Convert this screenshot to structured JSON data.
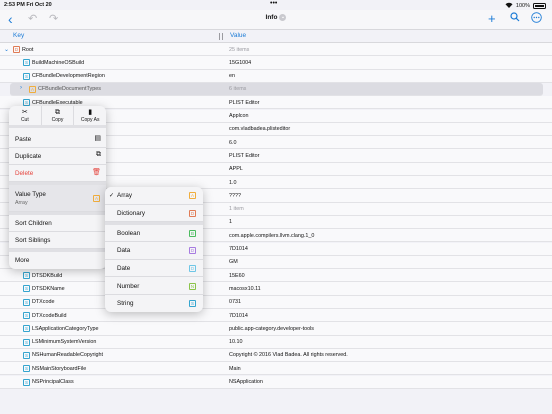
{
  "status": {
    "time": "2:53 PM",
    "date": "Fri Oct 20",
    "battery": "100%",
    "dots": "•••"
  },
  "nav": {
    "title": "Info",
    "chevron": "⌄",
    "back": "‹",
    "undo": "↶",
    "redo": "↷",
    "add": "+",
    "search": "⚲",
    "more": "⋯"
  },
  "header": {
    "key": "Key",
    "value": "Value"
  },
  "rows": [
    {
      "key": "Root",
      "value": "25 items",
      "type": "D",
      "typeclass": "dict",
      "indent": 1,
      "disc": "⌄",
      "gray": true
    },
    {
      "key": "BuildMachineOSBuild",
      "value": "15G1004",
      "type": "S",
      "indent": 2
    },
    {
      "key": "CFBundleDevelopmentRegion",
      "value": "en",
      "type": "S",
      "indent": 2
    },
    {
      "key": "CFBundleDocumentTypes",
      "value": "6 items",
      "type": "A",
      "typeclass": "arr",
      "indent": 2,
      "disc": "›",
      "gray": true,
      "selected": true
    },
    {
      "key": "CFBundleExecutable",
      "value": "PLIST Editor",
      "type": "S",
      "indent": 2
    },
    {
      "key": "",
      "value": "Applcon",
      "type": "",
      "indent": 2
    },
    {
      "key": "",
      "value": "com.vladbadea.plisteditor",
      "type": "",
      "indent": 2
    },
    {
      "key": "",
      "value": "6.0",
      "type": "",
      "indent": 2
    },
    {
      "key": "",
      "value": "PLIST Editor",
      "type": "",
      "indent": 2
    },
    {
      "key": "",
      "value": "APPL",
      "type": "",
      "indent": 2
    },
    {
      "key": "",
      "value": "1.0",
      "type": "",
      "indent": 2
    },
    {
      "key": "",
      "value": "????",
      "type": "",
      "indent": 2
    },
    {
      "key": "",
      "value": "1 item",
      "type": "",
      "indent": 2,
      "gray": true
    },
    {
      "key": "",
      "value": "1",
      "type": "",
      "indent": 2
    },
    {
      "key": "",
      "value": "com.apple.compilers.llvm.clang.1_0",
      "type": "",
      "indent": 2
    },
    {
      "key": "",
      "value": "7D1014",
      "type": "",
      "indent": 2
    },
    {
      "key": "",
      "value": "GM",
      "type": "",
      "indent": 2
    },
    {
      "key": "DTSDKBuild",
      "value": "15E60",
      "type": "S",
      "indent": 2
    },
    {
      "key": "DTSDKName",
      "value": "macosx10.11",
      "type": "S",
      "indent": 2
    },
    {
      "key": "DTXcode",
      "value": "0731",
      "type": "S",
      "indent": 2
    },
    {
      "key": "DTXcodeBuild",
      "value": "7D1014",
      "type": "S",
      "indent": 2
    },
    {
      "key": "LSApplicationCategoryType",
      "value": "public.app-category.developer-tools",
      "type": "S",
      "indent": 2
    },
    {
      "key": "LSMinimumSystemVersion",
      "value": "10.10",
      "type": "S",
      "indent": 2
    },
    {
      "key": "NSHumanReadableCopyright",
      "value": "Copyright © 2016 Vlad Badea. All rights reserved.",
      "type": "S",
      "indent": 2
    },
    {
      "key": "NSMainStoryboardFile",
      "value": "Main",
      "type": "S",
      "indent": 2
    },
    {
      "key": "NSPrincipalClass",
      "value": "NSApplication",
      "type": "S",
      "indent": 2
    }
  ],
  "context_menu": {
    "cut": "Cut",
    "copy": "Copy",
    "copy_as": "Copy As",
    "paste": "Paste",
    "duplicate": "Duplicate",
    "delete": "Delete",
    "value_type": "Value Type",
    "value_type_current": "Array",
    "sort_children": "Sort Children",
    "sort_siblings": "Sort Siblings",
    "more": "More"
  },
  "value_type_menu": [
    {
      "label": "Array",
      "badge": "A",
      "color": "#f0ad3c",
      "checked": true
    },
    {
      "label": "Dictionary",
      "badge": "D",
      "color": "#e07b55"
    },
    {
      "label": "Boolean",
      "badge": "B",
      "color": "#4cbb5f"
    },
    {
      "label": "Data",
      "badge": "D",
      "color": "#a77be0"
    },
    {
      "label": "Date",
      "badge": "D",
      "color": "#6ec6e6"
    },
    {
      "label": "Number",
      "badge": "N",
      "color": "#8bc34a"
    },
    {
      "label": "String",
      "badge": "S",
      "color": "#35a5cf"
    }
  ],
  "colors": {
    "accent": "#1b7bd6",
    "danger": "#e5443d"
  }
}
